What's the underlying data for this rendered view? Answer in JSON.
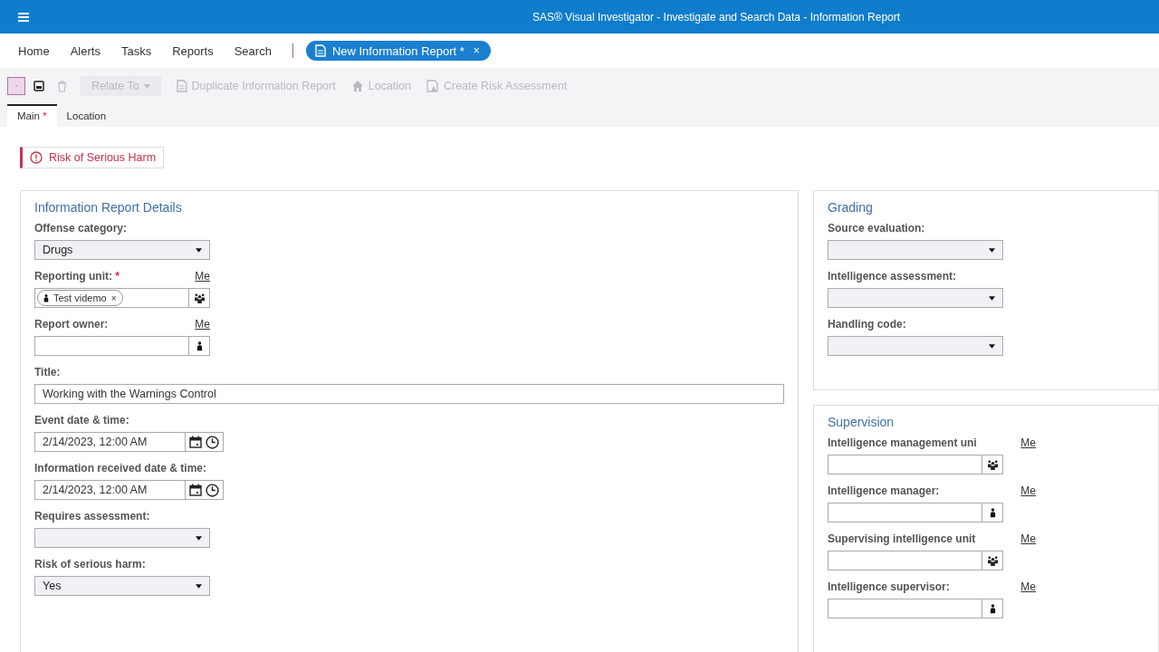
{
  "window": {
    "title": "SAS® Visual Investigator - Investigate and Search Data - Information Report"
  },
  "nav": {
    "items": [
      "Home",
      "Alerts",
      "Tasks",
      "Reports",
      "Search"
    ],
    "open_tab": {
      "label": "New Information Report *",
      "close": "×"
    }
  },
  "toolbar": [
    {
      "kind": "edit",
      "selected": true,
      "disabled": false
    },
    {
      "kind": "save",
      "selected": false,
      "disabled": false
    },
    {
      "kind": "delete",
      "selected": false,
      "disabled": true
    },
    {
      "kind": "dropdown",
      "label": "Relate To",
      "selected": false,
      "disabled": true
    },
    {
      "kind": "document",
      "label": "Duplicate Information Report",
      "selected": false,
      "disabled": true
    },
    {
      "kind": "home",
      "label": "Location",
      "selected": false,
      "disabled": true
    },
    {
      "kind": "risk",
      "label": "Create Risk Assessment",
      "selected": false,
      "disabled": true
    }
  ],
  "tabs": [
    {
      "label": "Main",
      "marker": "*",
      "selected": true
    },
    {
      "label": "Location",
      "selected": false
    }
  ],
  "warning": {
    "text": "Risk of Serious Harm"
  },
  "panels": [
    {
      "title": "Information Report Details",
      "fields": [
        {
          "label": "Offense category:",
          "kind": "select",
          "value": "Drugs"
        },
        {
          "label": "Reporting unit:",
          "required_mark": "*",
          "link": "Me",
          "kind": "group-picker",
          "chips": [
            {
              "text": "Test videmo",
              "remove": "×"
            }
          ]
        },
        {
          "label": "Report owner:",
          "link": "Me",
          "kind": "user-picker"
        },
        {
          "label": "Title:",
          "kind": "text",
          "value": "Working with the Warnings Control"
        },
        {
          "label": "Event date & time:",
          "kind": "datetime",
          "value": "2/14/2023, 12:00 AM"
        },
        {
          "label": "Information received date & time:",
          "kind": "datetime",
          "value": "2/14/2023, 12:00 AM"
        },
        {
          "label": "Requires assessment:",
          "kind": "select"
        },
        {
          "label": "Risk of serious harm:",
          "kind": "select",
          "value": "Yes"
        }
      ]
    },
    {
      "title": "Grading",
      "fields": [
        {
          "label": "Source evaluation:",
          "kind": "select"
        },
        {
          "label": "Intelligence assessment:",
          "kind": "select"
        },
        {
          "label": "Handling code:",
          "kind": "select"
        }
      ]
    },
    {
      "title": "Supervision",
      "fields": [
        {
          "label": "Intelligence management uni",
          "link": "Me",
          "kind": "group-picker"
        },
        {
          "label": "Intelligence manager:",
          "link": "Me",
          "kind": "user-picker"
        },
        {
          "label": "Supervising intelligence unit",
          "link": "Me",
          "kind": "group-picker"
        },
        {
          "label": "Intelligence supervisor:",
          "link": "Me",
          "kind": "user-picker"
        }
      ]
    }
  ]
}
